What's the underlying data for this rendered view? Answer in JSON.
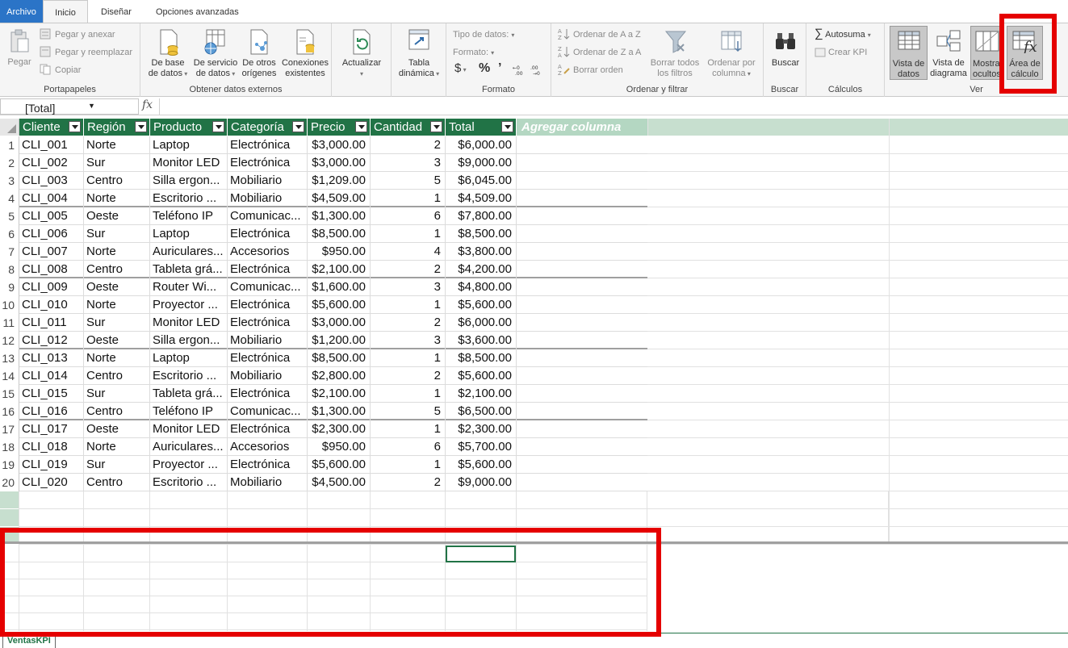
{
  "tabs": {
    "file": "Archivo",
    "home": "Inicio",
    "design": "Diseñar",
    "advanced": "Opciones avanzadas"
  },
  "ribbon": {
    "clipboard": {
      "paste": "Pegar",
      "paste_append": "Pegar y anexar",
      "paste_replace": "Pegar y reemplazar",
      "copy": "Copiar",
      "label": "Portapapeles"
    },
    "external": {
      "from_db_line1": "De base",
      "from_db_line2": "de datos",
      "from_service_line1": "De servicio",
      "from_service_line2": "de datos",
      "from_other_line1": "De otros",
      "from_other_line2": "orígenes",
      "existing_line1": "Conexiones",
      "existing_line2": "existentes",
      "label": "Obtener datos externos"
    },
    "refresh": "Actualizar",
    "pivot_line1": "Tabla",
    "pivot_line2": "dinámica",
    "format": {
      "data_type": "Tipo de datos:",
      "format": "Formato:",
      "currency": "$",
      "percent": "%",
      "thousands": "’",
      "label": "Formato"
    },
    "sort": {
      "az": "Ordenar de A a Z",
      "za": "Ordenar de Z a A",
      "clear": "Borrar orden",
      "clear_filters_line1": "Borrar todos",
      "clear_filters_line2": "los filtros",
      "by_column_line1": "Ordenar por",
      "by_column_line2": "columna",
      "label": "Ordenar y filtrar"
    },
    "find": {
      "find": "Buscar",
      "label": "Buscar"
    },
    "calc": {
      "autosum": "Autosuma",
      "kpi": "Crear KPI",
      "label": "Cálculos"
    },
    "view": {
      "data_view_line1": "Vista de",
      "data_view_line2": "datos",
      "diagram_line1": "Vista de",
      "diagram_line2": "diagrama",
      "show_hidden_line1": "Mostrar",
      "show_hidden_line2": "ocultos",
      "calc_area_line1": "Área de",
      "calc_area_line2": "cálculo",
      "label": "Ver"
    }
  },
  "formula_bar": {
    "name_box": "[Total]",
    "fx": "fx",
    "value": ""
  },
  "table": {
    "columns": [
      "Cliente",
      "Región",
      "Producto",
      "Categoría",
      "Precio",
      "Cantidad",
      "Total"
    ],
    "add_column": "Agregar columna",
    "rows": [
      {
        "n": "1",
        "c": [
          "CLI_001",
          "Norte",
          "Laptop",
          "Electrónica",
          "$3,000.00",
          "2",
          "$6,000.00"
        ]
      },
      {
        "n": "2",
        "c": [
          "CLI_002",
          "Sur",
          "Monitor LED",
          "Electrónica",
          "$3,000.00",
          "3",
          "$9,000.00"
        ]
      },
      {
        "n": "3",
        "c": [
          "CLI_003",
          "Centro",
          "Silla ergon...",
          "Mobiliario",
          "$1,209.00",
          "5",
          "$6,045.00"
        ]
      },
      {
        "n": "4",
        "c": [
          "CLI_004",
          "Norte",
          "Escritorio ...",
          "Mobiliario",
          "$4,509.00",
          "1",
          "$4,509.00"
        ]
      },
      {
        "n": "5",
        "c": [
          "CLI_005",
          "Oeste",
          "Teléfono IP",
          "Comunicac...",
          "$1,300.00",
          "6",
          "$7,800.00"
        ]
      },
      {
        "n": "6",
        "c": [
          "CLI_006",
          "Sur",
          "Laptop",
          " Electrónica",
          "$8,500.00",
          "1",
          "$8,500.00"
        ]
      },
      {
        "n": "7",
        "c": [
          "CLI_007",
          "Norte",
          "Auriculares...",
          "Accesorios",
          "$950.00",
          "4",
          "$3,800.00"
        ]
      },
      {
        "n": "8",
        "c": [
          "CLI_008",
          "Centro",
          "Tableta grá...",
          "Electrónica",
          "$2,100.00",
          "2",
          "$4,200.00"
        ]
      },
      {
        "n": "9",
        "c": [
          "CLI_009",
          "Oeste",
          "Router Wi...",
          "Comunicac...",
          "$1,600.00",
          "3",
          "$4,800.00"
        ]
      },
      {
        "n": "10",
        "c": [
          "CLI_010",
          "Norte",
          "Proyector ...",
          "Electrónica",
          "$5,600.00",
          "1",
          "$5,600.00"
        ]
      },
      {
        "n": "11",
        "c": [
          "CLI_011",
          "Sur",
          "Monitor LED",
          "Electrónica",
          "$3,000.00",
          "2",
          "$6,000.00"
        ]
      },
      {
        "n": "12",
        "c": [
          "CLI_012",
          "Oeste",
          "Silla ergon...",
          "Mobiliario",
          "$1,200.00",
          "3",
          "$3,600.00"
        ]
      },
      {
        "n": "13",
        "c": [
          "CLI_013",
          "Norte",
          "Laptop",
          " Electrónica",
          "$8,500.00",
          "1",
          "$8,500.00"
        ]
      },
      {
        "n": "14",
        "c": [
          "CLI_014",
          "Centro",
          "Escritorio ...",
          "Mobiliario",
          "$2,800.00",
          "2",
          "$5,600.00"
        ]
      },
      {
        "n": "15",
        "c": [
          "CLI_015",
          "Sur",
          "Tableta grá...",
          "Electrónica",
          "$2,100.00",
          "1",
          "$2,100.00"
        ]
      },
      {
        "n": "16",
        "c": [
          "CLI_016",
          "Centro",
          "Teléfono IP",
          "Comunicac...",
          "$1,300.00",
          "5",
          "$6,500.00"
        ]
      },
      {
        "n": "17",
        "c": [
          "CLI_017",
          "Oeste",
          "Monitor LED",
          "Electrónica",
          "$2,300.00",
          "1",
          "$2,300.00"
        ]
      },
      {
        "n": "18",
        "c": [
          "CLI_018",
          "Norte",
          "Auriculares...",
          "Accesorios",
          "$950.00",
          "6",
          "$5,700.00"
        ]
      },
      {
        "n": "19",
        "c": [
          "CLI_019",
          "Sur",
          "Proyector ...",
          " Electrónica",
          "$5,600.00",
          "1",
          "$5,600.00"
        ]
      },
      {
        "n": "20",
        "c": [
          "CLI_020",
          "Centro",
          "Escritorio ...",
          "Mobiliario",
          "$4,500.00",
          "2",
          "$9,000.00"
        ]
      }
    ]
  },
  "sheet_tab": "VentasKPI",
  "colors": {
    "accent_green": "#217346",
    "file_tab_blue": "#2b74c7",
    "highlight_red": "#e50000"
  }
}
